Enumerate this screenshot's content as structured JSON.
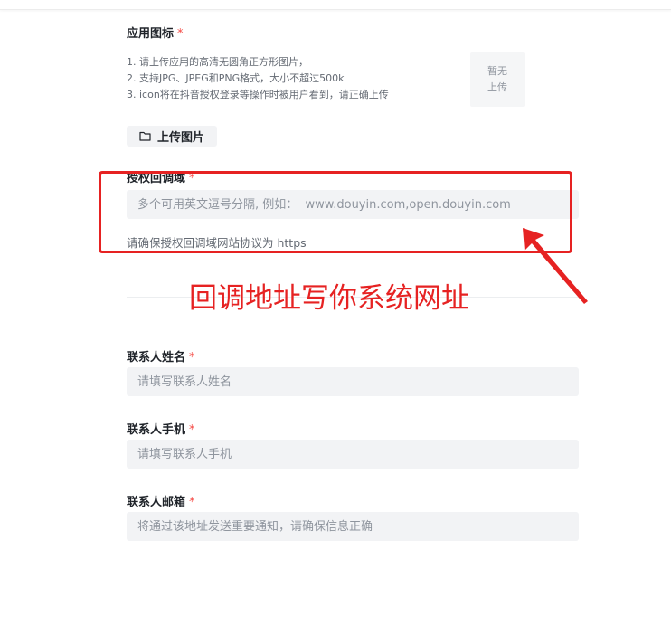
{
  "app_icon": {
    "label": "应用图标",
    "required": "*",
    "hints": [
      "1. 请上传应用的高清无圆角正方形图片，",
      "2. 支持JPG、JPEG和PNG格式，大小不超过500k",
      "3. icon将在抖音授权登录等操作时被用户看到，请正确上传"
    ],
    "preview_line1": "暂无",
    "preview_line2": "上传",
    "upload_label": "上传图片"
  },
  "callback_domain": {
    "label": "授权回调域",
    "required": "*",
    "placeholder": "多个可用英文逗号分隔, 例如：  www.douyin.com,open.douyin.com",
    "note": "请确保授权回调域网站协议为 https"
  },
  "annotation": {
    "text": "回调地址写你系统网址",
    "color": "#e62222"
  },
  "contact_name": {
    "label": "联系人姓名",
    "required": "*",
    "placeholder": "请填写联系人姓名"
  },
  "contact_phone": {
    "label": "联系人手机",
    "required": "*",
    "placeholder": "请填写联系人手机"
  },
  "contact_email": {
    "label": "联系人邮箱",
    "required": "*",
    "placeholder": "将通过该地址发送重要通知，请确保信息正确"
  }
}
